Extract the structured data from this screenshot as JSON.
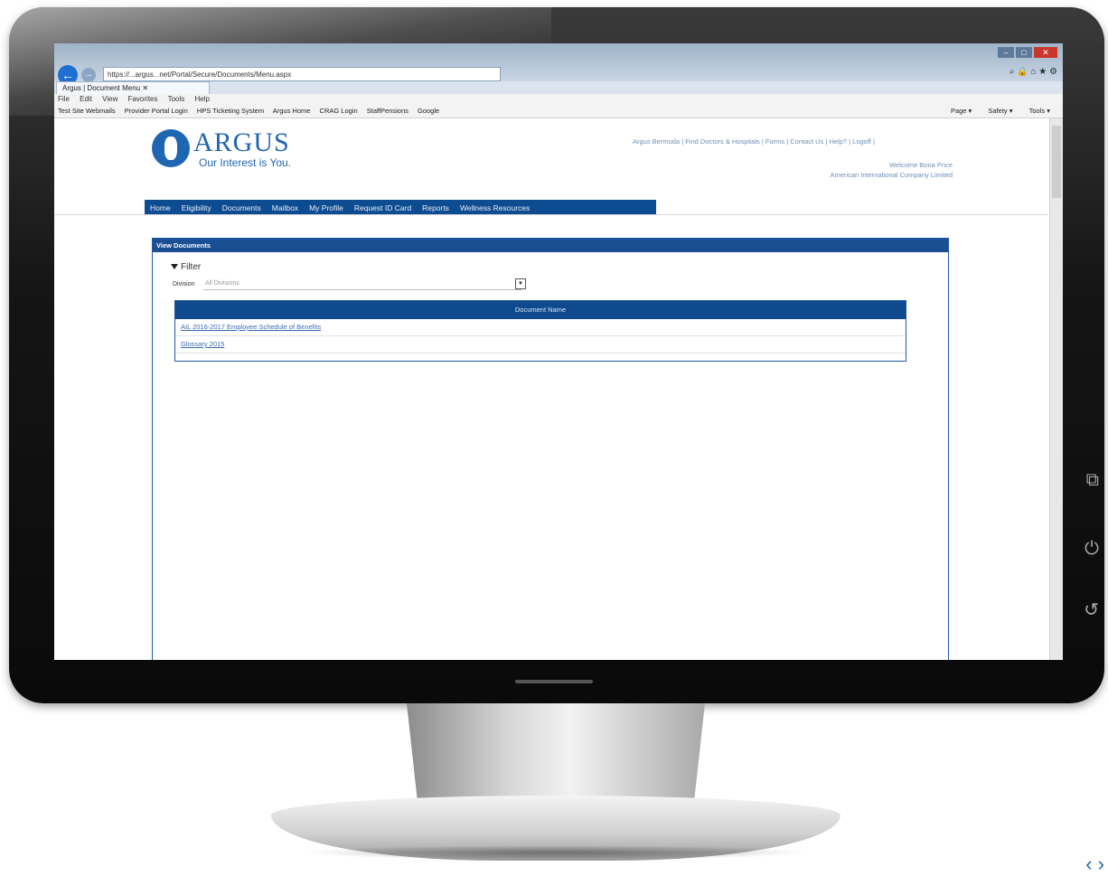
{
  "browser": {
    "address": "https://...argus...net/Portal/Secure/Documents/Menu.aspx",
    "tab_title": "Argus | Document Menu",
    "menu": [
      "File",
      "Edit",
      "View",
      "Favorites",
      "Tools",
      "Help"
    ],
    "favorites": [
      "Test Site Webmails",
      "Provider Portal Login",
      "HPS Ticketing System",
      "Argus Home",
      "CRAG Login",
      "StaffPensions",
      "Google"
    ],
    "commands": [
      "Page ▾",
      "Safety ▾",
      "Tools ▾"
    ]
  },
  "header": {
    "logo_name": "ARGUS",
    "logo_tagline": "Our Interest is You.",
    "top_links": "Argus Bermuda | Find Doctors & Hospitals | Forms | Contact Us | Help? | Logoff |",
    "welcome_line1": "Welcome Bona Price",
    "welcome_line2": "American International Company Limited"
  },
  "nav": [
    "Home",
    "Eligibility",
    "Documents",
    "Mailbox",
    "My Profile",
    "Request ID Card",
    "Reports",
    "Wellness Resources"
  ],
  "panel": {
    "title": "View Documents",
    "filter_label": "Filter",
    "division_label": "Division",
    "division_value": "All Divisions",
    "table_header": "Document Name",
    "documents": [
      "AIL 2016-2017 Employee Schedule of Benefits",
      "Glossary 2015"
    ]
  },
  "device_icons": [
    "window-icon",
    "power-icon",
    "back-icon"
  ]
}
